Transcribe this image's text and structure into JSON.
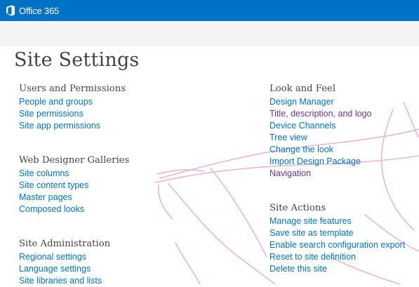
{
  "header": {
    "brand": "Office 365"
  },
  "page": {
    "title": "Site Settings"
  },
  "sections": {
    "users_permissions": {
      "title": "Users and Permissions",
      "links": [
        "People and groups",
        "Site permissions",
        "Site app permissions"
      ]
    },
    "web_designer_galleries": {
      "title": "Web Designer Galleries",
      "links": [
        "Site columns",
        "Site content types",
        "Master pages",
        "Composed looks"
      ]
    },
    "site_administration": {
      "title": "Site Administration",
      "links": [
        "Regional settings",
        "Language settings",
        "Site libraries and lists"
      ]
    },
    "look_and_feel": {
      "title": "Look and Feel",
      "links": [
        "Design Manager",
        "Title, description, and logo",
        "Device Channels",
        "Tree view",
        "Change the look",
        "Import Design Package",
        "Navigation"
      ]
    },
    "site_actions": {
      "title": "Site Actions",
      "links": [
        "Manage site features",
        "Save site as template",
        "Enable search configuration export",
        "Reset to site definition",
        "Delete this site"
      ]
    }
  },
  "colors": {
    "suite_bar": "#0072c6",
    "link": "#0072c6",
    "visited_link": "#663399",
    "heading": "#444444",
    "background_sketch": "#e8a9c8"
  }
}
